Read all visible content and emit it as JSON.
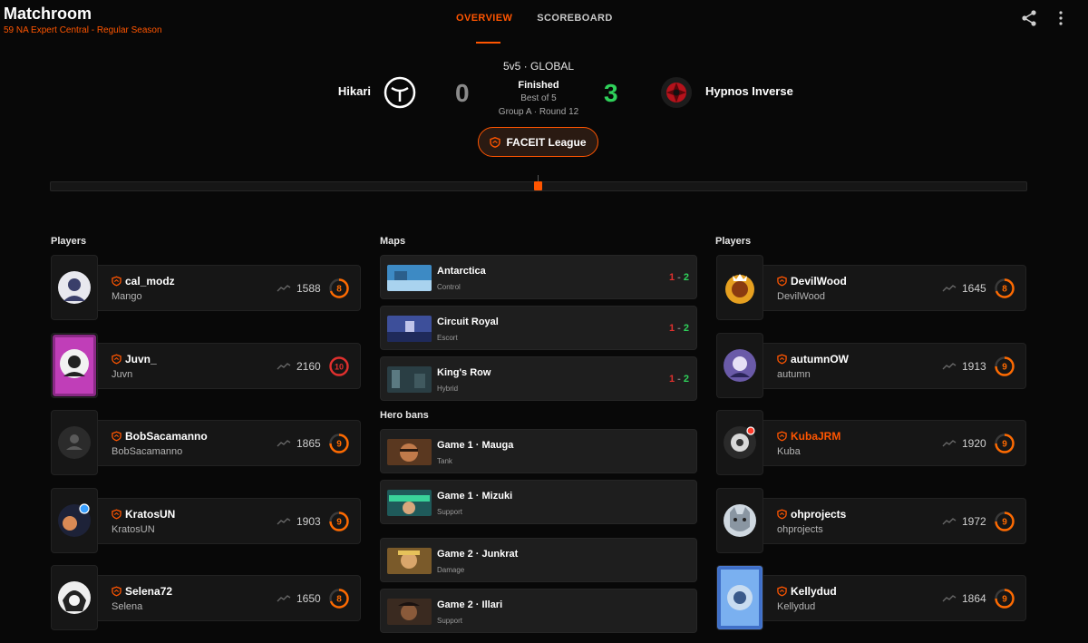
{
  "header": {
    "title": "Matchroom",
    "subtitle": "59 NA Expert Central - Regular Season",
    "tabs": [
      "OVERVIEW",
      "SCOREBOARD"
    ],
    "active_tab": "OVERVIEW",
    "icons": [
      "share-icon",
      "more-vertical-icon"
    ]
  },
  "match": {
    "mode": "5v5 · GLOBAL",
    "team1": {
      "name": "Hikari",
      "score": "0",
      "logo_icon": "hikari-logo"
    },
    "team2": {
      "name": "Hypnos Inverse",
      "score": "3",
      "logo_icon": "hypnos-logo"
    },
    "status": "Finished",
    "format": "Best of 5",
    "group_round": "Group A · Round 12",
    "league": "FACEIT League",
    "colors": {
      "accent": "#ff5500",
      "win": "#2fd15a",
      "loss": "#e0302e"
    }
  },
  "team1_players": {
    "heading": "Players",
    "items": [
      {
        "nickname": "cal_modz",
        "realname": "Mango",
        "elo": "1588",
        "level": "8"
      },
      {
        "nickname": "Juvn_",
        "realname": "Juvn",
        "elo": "2160",
        "level": "10"
      },
      {
        "nickname": "BobSacamanno",
        "realname": "BobSacamanno",
        "elo": "1865",
        "level": "9"
      },
      {
        "nickname": "KratosUN",
        "realname": "KratosUN",
        "elo": "1903",
        "level": "9"
      },
      {
        "nickname": "Selena72",
        "realname": "Selena",
        "elo": "1650",
        "level": "8"
      }
    ]
  },
  "maps": {
    "heading": "Maps",
    "items": [
      {
        "name": "Antarctica",
        "type": "Control",
        "score_left": "1",
        "sep": "-",
        "score_right": "2"
      },
      {
        "name": "Circuit Royal",
        "type": "Escort",
        "score_left": "1",
        "sep": "-",
        "score_right": "2"
      },
      {
        "name": "King's Row",
        "type": "Hybrid",
        "score_left": "1",
        "sep": "-",
        "score_right": "2"
      }
    ]
  },
  "hero_bans": {
    "heading": "Hero bans",
    "items": [
      {
        "label": "Game 1 · Mauga",
        "role": "Tank"
      },
      {
        "label": "Game 1 · Mizuki",
        "role": "Support"
      },
      {
        "label": "Game 2 · Junkrat",
        "role": "Damage"
      },
      {
        "label": "Game 2 · Illari",
        "role": "Support"
      }
    ]
  },
  "team2_players": {
    "heading": "Players",
    "items": [
      {
        "nickname": "DevilWood",
        "realname": "DevilWood",
        "elo": "1645",
        "level": "8"
      },
      {
        "nickname": "autumnOW",
        "realname": "autumn",
        "elo": "1913",
        "level": "9"
      },
      {
        "nickname": "KubaJRM",
        "realname": "Kuba",
        "elo": "1920",
        "level": "9"
      },
      {
        "nickname": "ohprojects",
        "realname": "ohprojects",
        "elo": "1972",
        "level": "9"
      },
      {
        "nickname": "Kellydud",
        "realname": "Kellydud",
        "elo": "1864",
        "level": "9"
      }
    ]
  }
}
